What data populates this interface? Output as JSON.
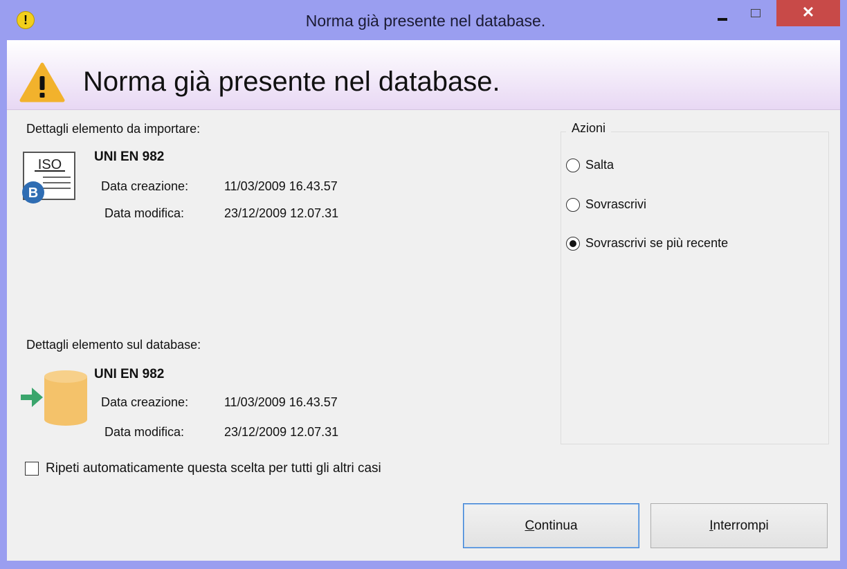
{
  "window": {
    "title": "Norma già presente nel database.",
    "close_glyph": "✕",
    "title_icon_glyph": "!"
  },
  "header": {
    "title": "Norma già presente nel database."
  },
  "import_item": {
    "section_label": "Dettagli elemento da importare:",
    "icon_text": "ISO",
    "badge_letter": "B",
    "name": "UNI EN 982",
    "created_label": "Data creazione:",
    "created_value": "11/03/2009 16.43.57",
    "modified_label": "Data modifica:",
    "modified_value": "23/12/2009 12.07.31"
  },
  "db_item": {
    "section_label": "Dettagli elemento sul database:",
    "name": "UNI EN 982",
    "created_label": "Data creazione:",
    "created_value": "11/03/2009 16.43.57",
    "modified_label": "Data modifica:",
    "modified_value": "23/12/2009 12.07.31"
  },
  "actions": {
    "legend": "Azioni",
    "options": [
      {
        "label": "Salta",
        "checked": false
      },
      {
        "label": "Sovrascrivi",
        "checked": false
      },
      {
        "label": "Sovrascrivi se più recente",
        "checked": true
      }
    ]
  },
  "repeat_checkbox": {
    "label": "Ripeti automaticamente questa scelta per tutti gli altri casi",
    "checked": false
  },
  "buttons": {
    "continue_first": "C",
    "continue_rest": "ontinua",
    "stop_first": "I",
    "stop_rest": "nterrompi"
  },
  "colors": {
    "titlebar": "#9a9ef0",
    "close_button": "#c84a48",
    "warning": "#f2b22c",
    "database": "#f4c26a",
    "arrow": "#3aa56c",
    "badge": "#2f6db3"
  }
}
